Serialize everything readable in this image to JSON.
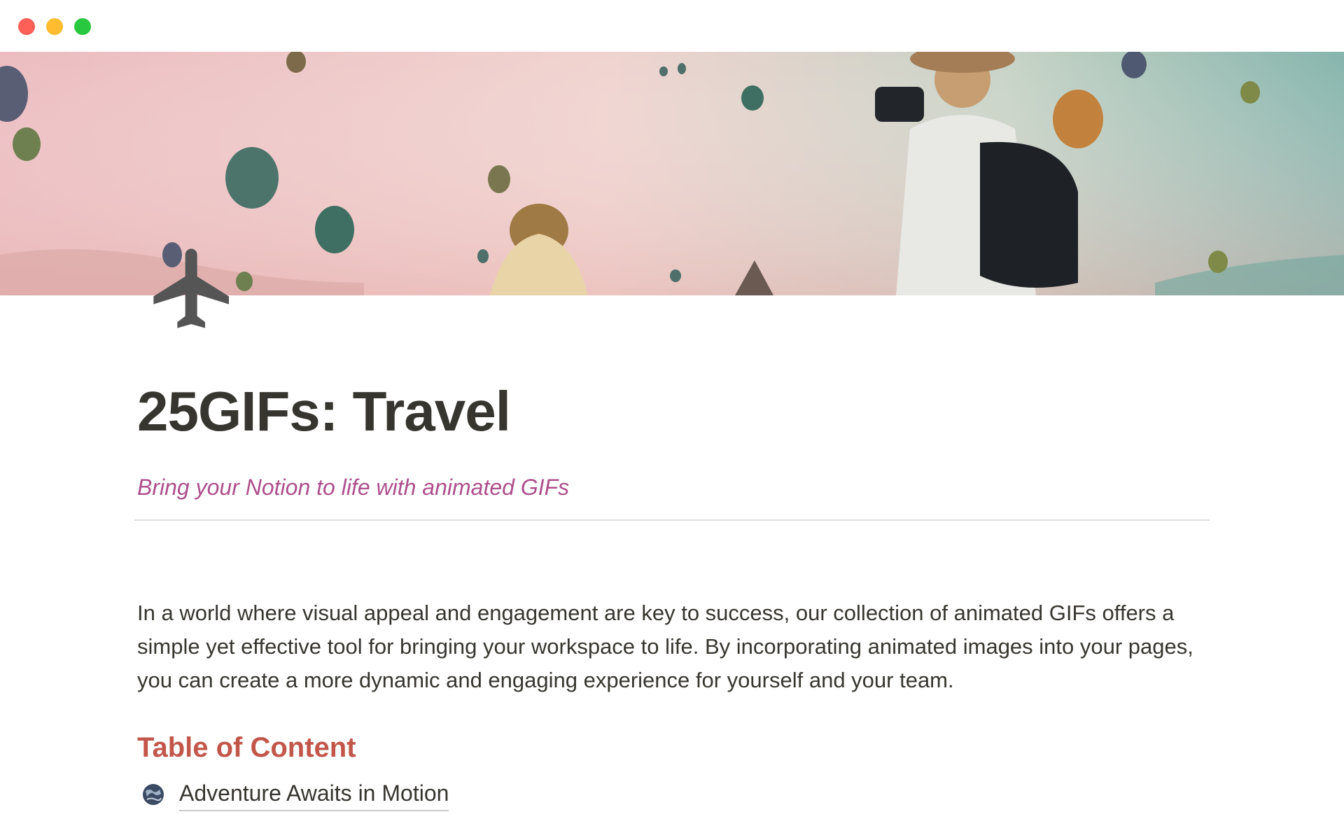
{
  "window": {
    "controls": [
      "close",
      "minimize",
      "zoom"
    ]
  },
  "cover": {
    "description_icon": "hot-air-balloon-cover-image"
  },
  "page": {
    "icon": "airplane-icon",
    "title": "25GIFs: Travel",
    "subtitle": "Bring your Notion to life with animated GIFs",
    "intro": "In a world where visual appeal and engagement are key to success, our collection of animated GIFs offers a simple yet effective tool for bringing your workspace to life. By incorporating animated images into your pages, you can create a more dynamic and engaging experience for yourself and your team."
  },
  "toc": {
    "heading": "Table of Content",
    "items": [
      {
        "label": "Adventure Awaits in Motion",
        "icon": "globe-icon"
      }
    ]
  },
  "colors": {
    "title": "#37352f",
    "subtitle": "#ad4f8c",
    "toc_heading": "#c2564a",
    "close": "#fe5f57",
    "minimize": "#febc2e",
    "zoom": "#28c840"
  }
}
